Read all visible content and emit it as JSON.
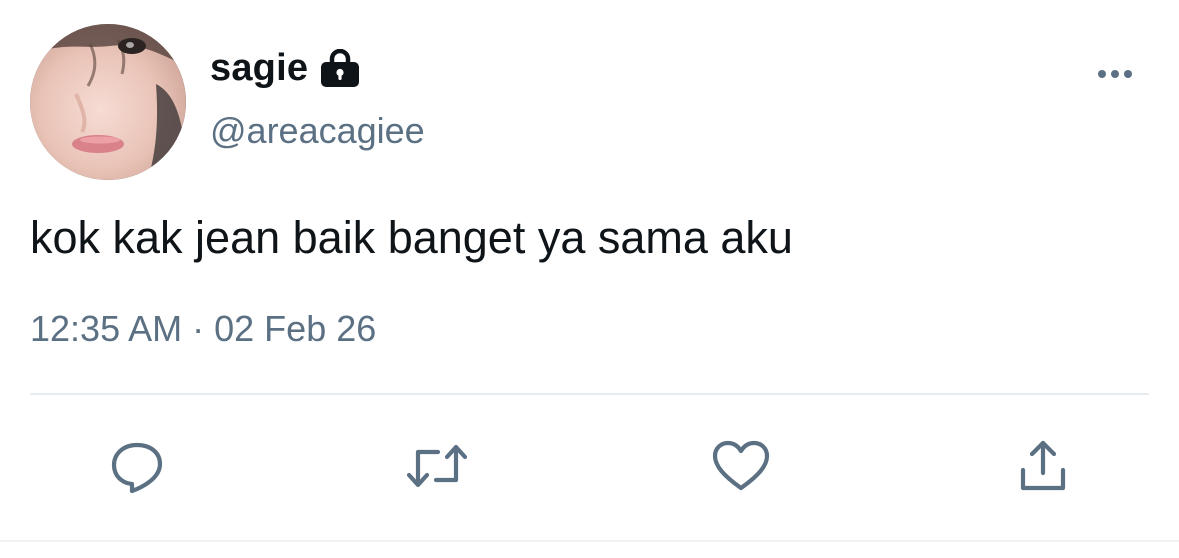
{
  "tweet": {
    "author": {
      "display_name": "sagie",
      "handle": "@areacagiee",
      "protected_icon": "lock-icon",
      "avatar": "profile-photo"
    },
    "text": "kok kak jean baik banget ya sama aku",
    "time": "12:35 AM",
    "separator": "·",
    "date": "02 Feb 26"
  },
  "actions": [
    {
      "name": "reply",
      "icon": "speech-bubble-icon"
    },
    {
      "name": "retweet",
      "icon": "retweet-arrows-icon"
    },
    {
      "name": "like",
      "icon": "heart-icon"
    },
    {
      "name": "share",
      "icon": "share-upload-icon"
    }
  ],
  "menu_icon": "more-horizontal-icon",
  "colors": {
    "text_primary": "#0f1419",
    "text_secondary": "#5b7083",
    "icon": "#5b7083",
    "divider": "#e6ecf0",
    "background": "#ffffff"
  }
}
